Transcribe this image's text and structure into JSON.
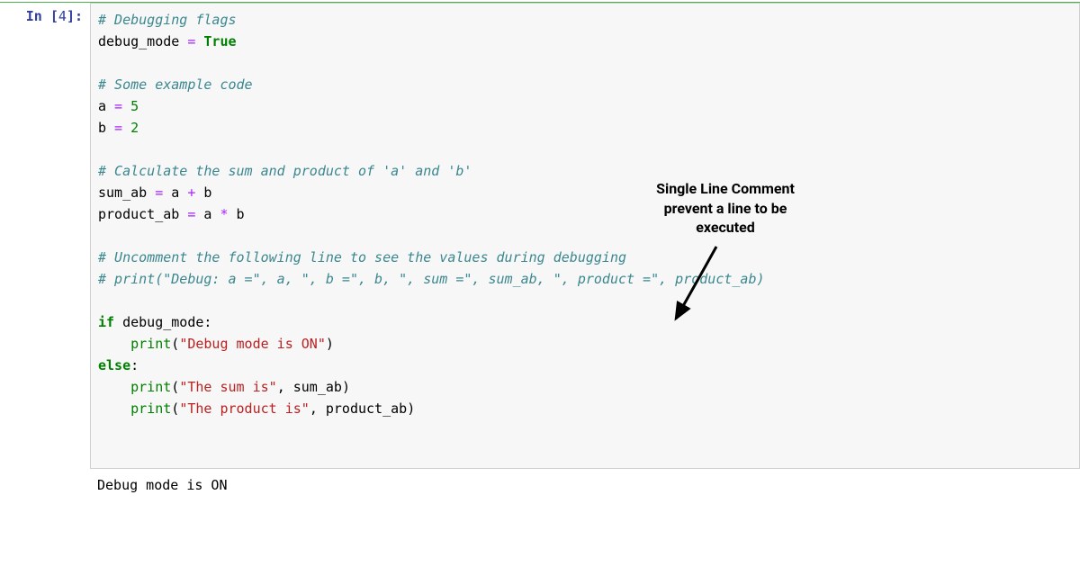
{
  "prompt": {
    "label": "In [",
    "num": "4",
    "close": "]:"
  },
  "code": {
    "l1_comment": "# Debugging flags",
    "l2_name": "debug_mode",
    "l2_op": " = ",
    "l2_val": "True",
    "l4_comment": "# Some example code",
    "l5_name": "a",
    "l5_op": " = ",
    "l5_val": "5",
    "l6_name": "b",
    "l6_op": " = ",
    "l6_val": "2",
    "l8_comment": "# Calculate the sum and product of 'a' and 'b'",
    "l9_name": "sum_ab",
    "l9_op": " = ",
    "l9_a": "a",
    "l9_plus": " + ",
    "l9_b": "b",
    "l10_name": "product_ab",
    "l10_op": " = ",
    "l10_a": "a",
    "l10_mul": " * ",
    "l10_b": "b",
    "l12_comment": "# Uncomment the following line to see the values during debugging",
    "l13_comment": "# print(\"Debug: a =\", a, \", b =\", b, \", sum =\", sum_ab, \", product =\", product_ab)",
    "l15_if": "if",
    "l15_sp": " ",
    "l15_cond": "debug_mode",
    "l15_colon": ":",
    "l16_indent": "    ",
    "l16_print": "print",
    "l16_open": "(",
    "l16_str": "\"Debug mode is ON\"",
    "l16_close": ")",
    "l17_else": "else",
    "l17_colon": ":",
    "l18_indent": "    ",
    "l18_print": "print",
    "l18_open": "(",
    "l18_str": "\"The sum is\"",
    "l18_comma": ", ",
    "l18_arg": "sum_ab",
    "l18_close": ")",
    "l19_indent": "    ",
    "l19_print": "print",
    "l19_open": "(",
    "l19_str": "\"The product is\"",
    "l19_comma": ", ",
    "l19_arg": "product_ab",
    "l19_close": ")"
  },
  "output": {
    "text": "Debug mode is ON"
  },
  "annotation": {
    "line1": "Single Line Comment",
    "line2": "prevent a line to be",
    "line3": "executed"
  }
}
